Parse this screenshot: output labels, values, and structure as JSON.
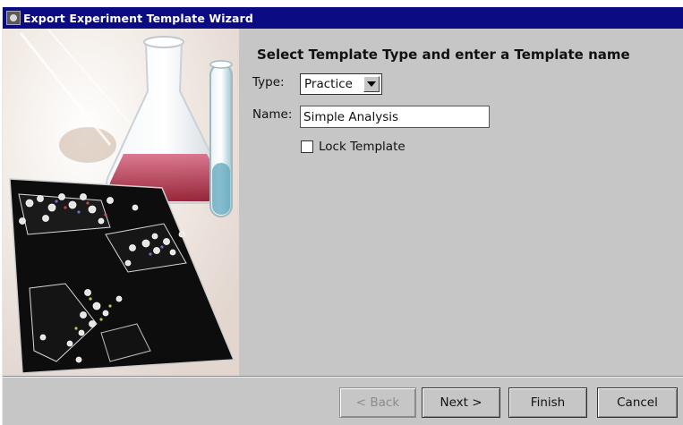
{
  "window": {
    "title": "Export Experiment Template Wizard",
    "icon": "app-window-icon"
  },
  "form": {
    "heading": "Select Template Type and enter a Template name",
    "type_label": "Type:",
    "type_value": "Practice",
    "name_label": "Name:",
    "name_value": "Simple Analysis",
    "lock_label": "Lock Template",
    "lock_checked": false
  },
  "buttons": {
    "back": "< Back",
    "next": "Next >",
    "finish": "Finish",
    "cancel": "Cancel"
  },
  "colors": {
    "titlebar": "#0b0b84",
    "panel": "#c6c6c6"
  }
}
